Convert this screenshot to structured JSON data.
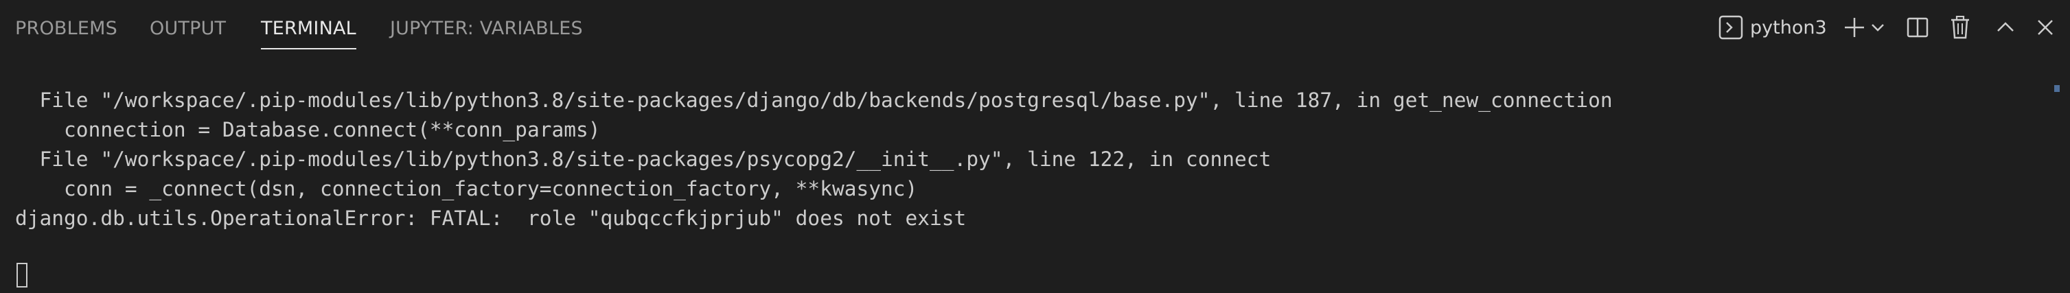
{
  "tabs": [
    {
      "label": "PROBLEMS",
      "active": false
    },
    {
      "label": "OUTPUT",
      "active": false
    },
    {
      "label": "TERMINAL",
      "active": true
    },
    {
      "label": "JUPYTER: VARIABLES",
      "active": false
    }
  ],
  "toolbar": {
    "shell_icon": "terminal-icon",
    "shell_label": "python3",
    "icons": [
      "plus-icon",
      "chevron-down-icon",
      "split-icon",
      "trash-icon",
      "chevron-up-icon",
      "close-icon"
    ]
  },
  "terminal": {
    "lines": [
      "  File \"/workspace/.pip-modules/lib/python3.8/site-packages/django/db/backends/postgresql/base.py\", line 187, in get_new_connection",
      "    connection = Database.connect(**conn_params)",
      "  File \"/workspace/.pip-modules/lib/python3.8/site-packages/psycopg2/__init__.py\", line 122, in connect",
      "    conn = _connect(dsn, connection_factory=connection_factory, **kwasync)",
      "django.db.utils.OperationalError: FATAL:  role \"qubqccfkjprjub\" does not exist"
    ]
  },
  "colors": {
    "background": "#1e1e1e",
    "text": "#cccccc",
    "tab_inactive": "#9a9a9a",
    "tab_active": "#e8e8e8"
  }
}
